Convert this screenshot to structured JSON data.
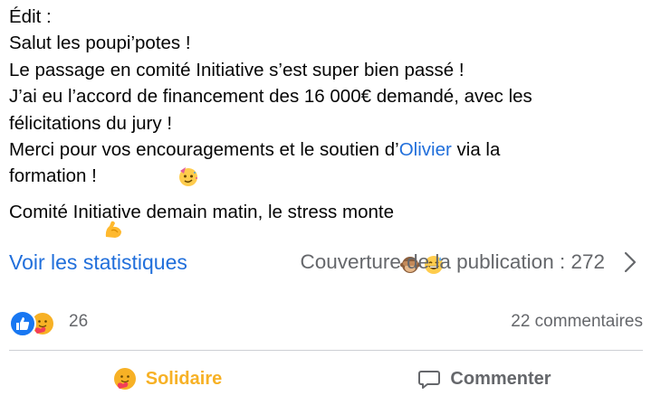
{
  "post": {
    "lines": [
      [
        "Édit :"
      ],
      [
        "Salut les poupi’potes !"
      ],
      [
        "Le passage en comité Initiative s’est super bien passé !"
      ],
      [
        "J’ai eu l’accord de financement des 16 000€ demandé, avec les"
      ],
      [
        "félicitations du jury !"
      ],
      [
        "Merci pour vos encouragements et le soutien d’",
        "Olivier",
        " via la"
      ],
      [
        "formation !"
      ],
      [
        "Comité Initiative demain matin, le stress monte"
      ]
    ],
    "mention": "Olivier",
    "emojis": [
      "partying-face-emoji",
      "flexed-biceps-emoji",
      "see-no-evil-monkey-emoji",
      "grinning-sweat-emoji"
    ]
  },
  "stats": {
    "link_label": "Voir les statistiques",
    "reach_label": "Couverture de la publication : 272"
  },
  "reactions": {
    "icons": [
      "like-reaction-icon",
      "care-reaction-icon"
    ],
    "count": "26",
    "comments": "22 commentaires"
  },
  "actions": {
    "reaction_label": "Solidaire",
    "comment_label": "Commenter"
  },
  "colors": {
    "link": "#216fdb",
    "secondary_text": "#65676b",
    "solidaire": "#f7b125",
    "like_blue": "#1877f2"
  }
}
